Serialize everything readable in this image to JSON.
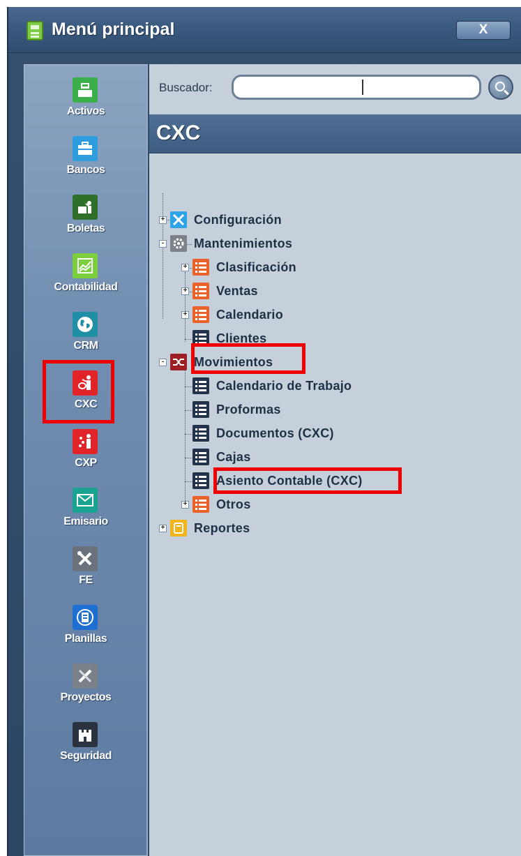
{
  "window": {
    "title": "Menú principal",
    "close_label": "X"
  },
  "nav": {
    "items": [
      {
        "label": "Activos",
        "icon": "cash-register-icon",
        "color": "#3bb04a"
      },
      {
        "label": "Bancos",
        "icon": "briefcase-icon",
        "color": "#2e9de0"
      },
      {
        "label": "Boletas",
        "icon": "teacher-board-icon",
        "color": "#2f6f2a"
      },
      {
        "label": "Contabilidad",
        "icon": "chart-icon",
        "color": "#7ccf3c"
      },
      {
        "label": "CRM",
        "icon": "globe-icon",
        "color": "#1f8fa6"
      },
      {
        "label": "CXC",
        "icon": "person-receiving-icon",
        "color": "#e0242a",
        "selected": true
      },
      {
        "label": "CXP",
        "icon": "person-paying-icon",
        "color": "#e0242a"
      },
      {
        "label": "Emisario",
        "icon": "envelope-icon",
        "color": "#1aa390"
      },
      {
        "label": "FE",
        "icon": "tools-icon",
        "color": "#6a737c"
      },
      {
        "label": "Planillas",
        "icon": "document-icon",
        "color": "#1d6fd1"
      },
      {
        "label": "Proyectos",
        "icon": "pencil-ruler-icon",
        "color": "#7a8088"
      },
      {
        "label": "Seguridad",
        "icon": "castle-icon",
        "color": "#2a3340"
      }
    ]
  },
  "search": {
    "label": "Buscador:",
    "value": "",
    "button_icon": "search-icon"
  },
  "section": {
    "title": "CXC"
  },
  "tree": [
    {
      "label": "Configuración",
      "level": 0,
      "expander": "+",
      "icon": "tools-icon",
      "icon_color": "#2ea3e6"
    },
    {
      "label": "Mantenimientos",
      "level": 0,
      "expander": "-",
      "icon": "gear-icon",
      "icon_color": "#7d8288"
    },
    {
      "label": "Clasificación",
      "level": 1,
      "expander": "+",
      "icon": "list-icon",
      "icon_color": "#e8622a"
    },
    {
      "label": "Ventas",
      "level": 1,
      "expander": "+",
      "icon": "list-icon",
      "icon_color": "#e8622a"
    },
    {
      "label": "Calendario",
      "level": 1,
      "expander": "+",
      "icon": "list-icon",
      "icon_color": "#e8622a"
    },
    {
      "label": "Clientes",
      "level": 1,
      "expander": "",
      "icon": "list-icon",
      "icon_color": "#22324a"
    },
    {
      "label": "Movimientos",
      "level": 0,
      "expander": "-",
      "icon": "shuffle-icon",
      "icon_color": "#9b1f25",
      "highlighted": true
    },
    {
      "label": "Calendario de Trabajo",
      "level": 1,
      "expander": "",
      "icon": "list-icon",
      "icon_color": "#22324a"
    },
    {
      "label": "Proformas",
      "level": 1,
      "expander": "",
      "icon": "list-icon",
      "icon_color": "#22324a"
    },
    {
      "label": "Documentos (CXC)",
      "level": 1,
      "expander": "",
      "icon": "list-icon",
      "icon_color": "#22324a"
    },
    {
      "label": "Cajas",
      "level": 1,
      "expander": "",
      "icon": "list-icon",
      "icon_color": "#22324a"
    },
    {
      "label": "Asiento Contable (CXC)",
      "level": 1,
      "expander": "",
      "icon": "list-icon",
      "icon_color": "#22324a",
      "highlighted": true
    },
    {
      "label": "Otros",
      "level": 1,
      "expander": "+",
      "icon": "list-icon",
      "icon_color": "#e8622a"
    },
    {
      "label": "Reportes",
      "level": 0,
      "expander": "+",
      "icon": "folder-icon",
      "icon_color": "#f2b51c"
    }
  ]
}
